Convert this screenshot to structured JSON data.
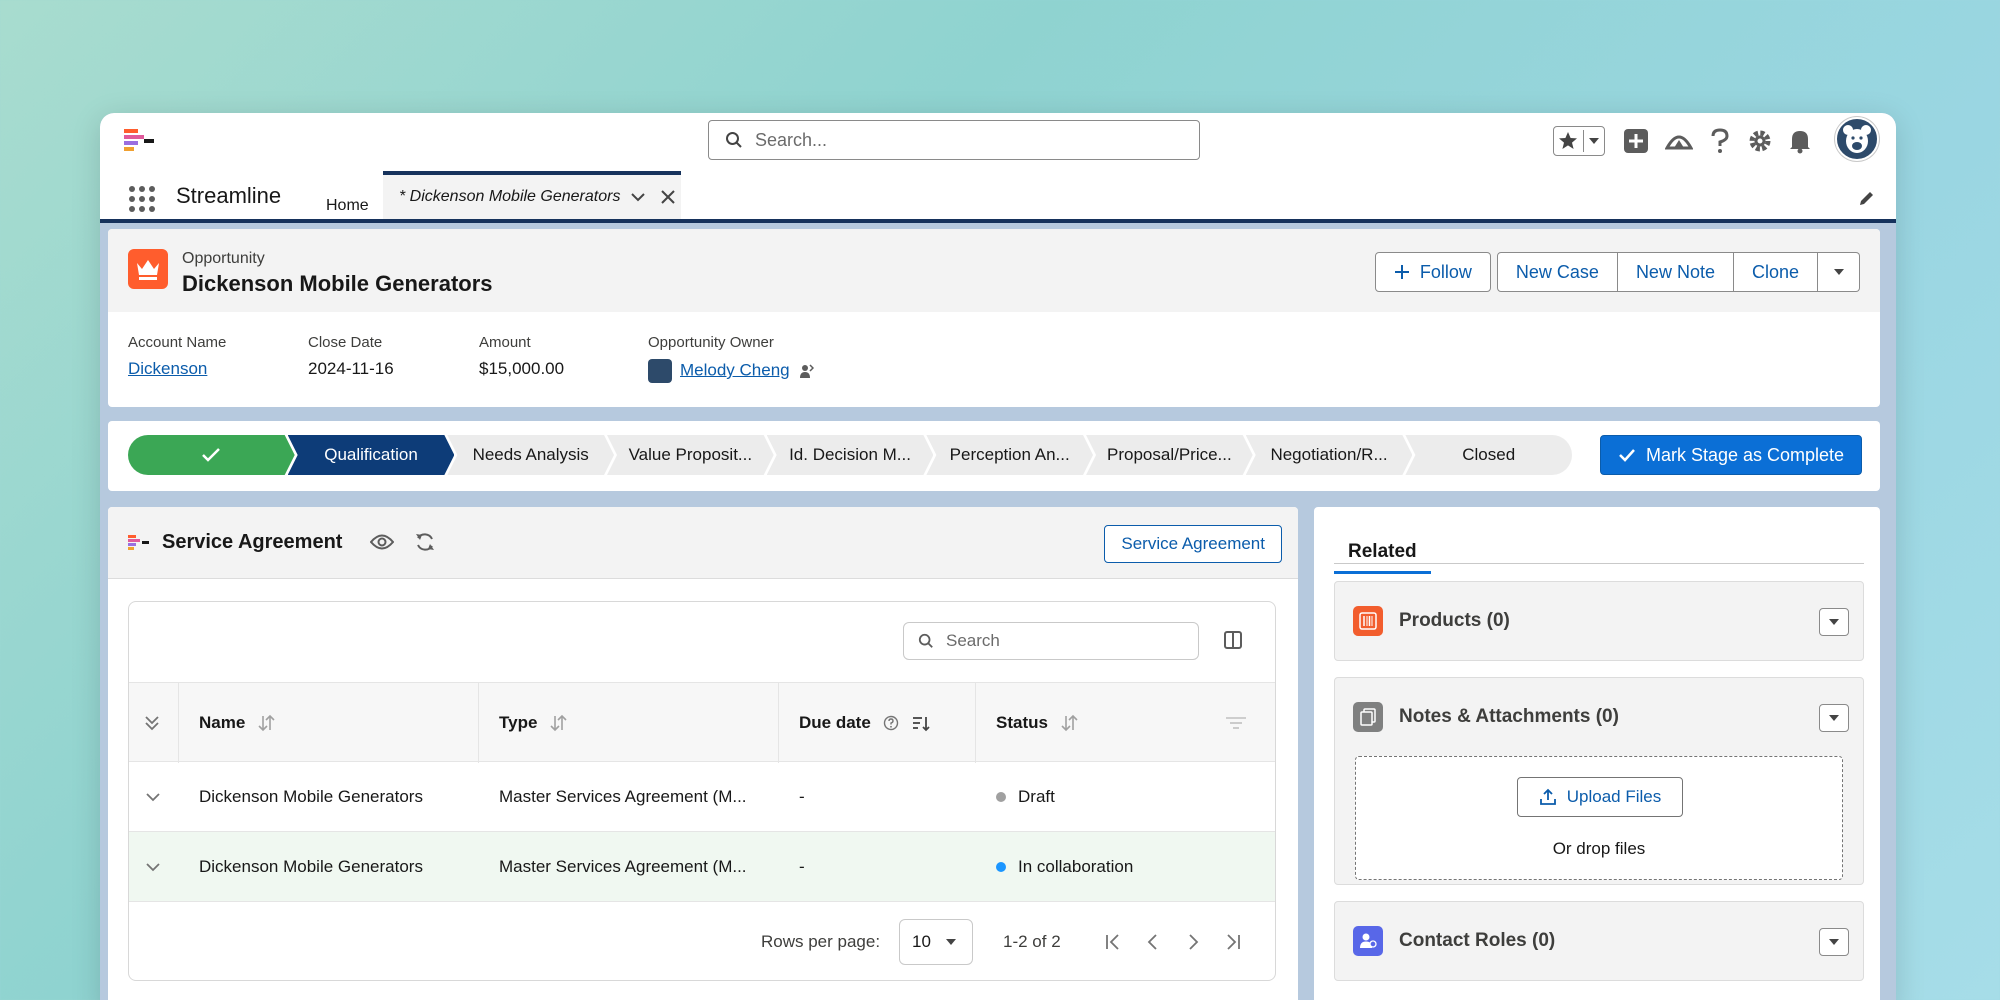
{
  "header": {
    "search_placeholder": "Search...",
    "app_name": "Streamline",
    "home_label": "Home",
    "active_tab_label": "* Dickenson Mobile Generators"
  },
  "record": {
    "object_type": "Opportunity",
    "title": "Dickenson Mobile Generators",
    "actions": {
      "follow": "Follow",
      "new_case": "New Case",
      "new_note": "New Note",
      "clone": "Clone"
    },
    "fields": {
      "account_name_label": "Account Name",
      "account_name": "Dickenson",
      "close_date_label": "Close Date",
      "close_date": "2024-11-16",
      "amount_label": "Amount",
      "amount": "$15,000.00",
      "owner_label": "Opportunity Owner",
      "owner": "Melody Cheng"
    }
  },
  "path": {
    "stages": [
      "",
      "Qualification",
      "Needs Analysis",
      "Value Proposit...",
      "Id. Decision M...",
      "Perception An...",
      "Proposal/Price...",
      "Negotiation/R...",
      "Closed"
    ],
    "mark_complete_label": "Mark Stage as Complete"
  },
  "service_agreement": {
    "title": "Service Agreement",
    "button_label": "Service Agreement",
    "search_placeholder": "Search",
    "columns": {
      "name": "Name",
      "type": "Type",
      "due_date": "Due date",
      "status": "Status"
    },
    "rows": [
      {
        "name": "Dickenson Mobile Generators",
        "type": "Master Services Agreement (M...",
        "due": "-",
        "status": "Draft",
        "status_color": "#a0a0a0"
      },
      {
        "name": "Dickenson Mobile Generators",
        "type": "Master Services Agreement (M...",
        "due": "-",
        "status": "In collaboration",
        "status_color": "#1b96ff"
      }
    ],
    "pager": {
      "rows_per_page_label": "Rows per page:",
      "rows_per_page": "10",
      "range": "1-2 of 2"
    }
  },
  "related": {
    "tab_label": "Related",
    "products": "Products (0)",
    "notes": "Notes & Attachments (0)",
    "upload_label": "Upload Files",
    "drop_text": "Or drop files",
    "contact_roles": "Contact Roles (0)"
  },
  "colors": {
    "brand_navy": "#16325c",
    "primary_blue": "#0b6fd6",
    "success_green": "#3ba755",
    "opportunity_orange": "#ff5d2d"
  }
}
